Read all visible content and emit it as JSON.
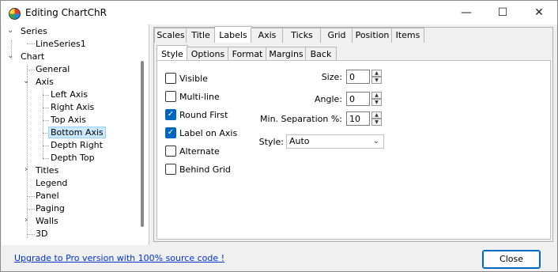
{
  "window": {
    "title": "Editing ChartChR",
    "minimize": "—",
    "maximize": "☐",
    "close": "✕"
  },
  "tree": {
    "series": "Series",
    "line_series": "LineSeries1",
    "chart": "Chart",
    "general": "General",
    "axis": "Axis",
    "left_axis": "Left Axis",
    "right_axis": "Right Axis",
    "top_axis": "Top Axis",
    "bottom_axis": "Bottom Axis",
    "depth_right": "Depth Right",
    "depth_top": "Depth Top",
    "titles": "Titles",
    "legend": "Legend",
    "panel": "Panel",
    "paging": "Paging",
    "walls": "Walls",
    "three_d": "3D"
  },
  "tabs": [
    "Scales",
    "Title",
    "Labels",
    "Axis",
    "Ticks",
    "Grid",
    "Position",
    "Items"
  ],
  "subtabs": [
    "Style",
    "Options",
    "Format",
    "Margins",
    "Back"
  ],
  "options": {
    "visible": "Visible",
    "multiline": "Multi-line",
    "round_first": "Round First",
    "label_on_axis": "Label on Axis",
    "alternate": "Alternate",
    "behind_grid": "Behind Grid"
  },
  "fields": {
    "size_label": "Size:",
    "size_value": "0",
    "angle_label": "Angle:",
    "angle_value": "0",
    "min_sep_label": "Min. Separation %:",
    "min_sep_value": "10",
    "style_label": "Style:",
    "style_value": "Auto"
  },
  "footer": {
    "link": "Upgrade to Pro version with 100% source code !",
    "close": "Close"
  }
}
